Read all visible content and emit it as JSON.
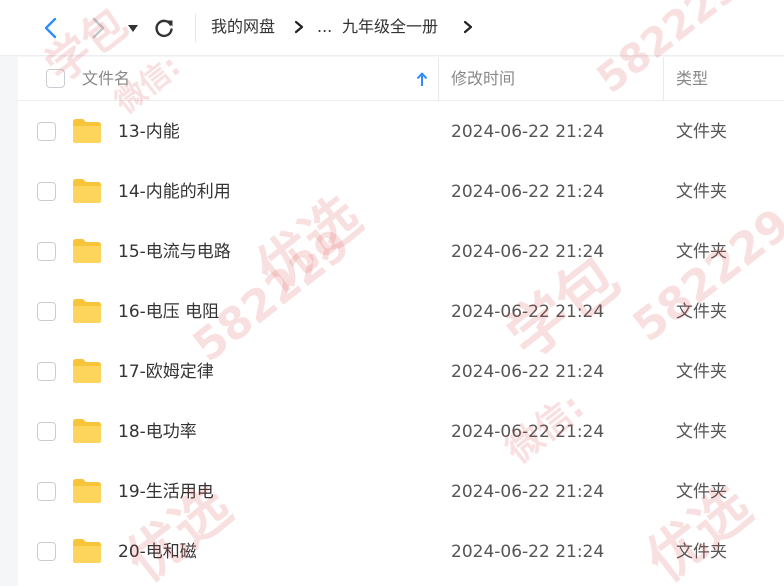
{
  "toolbar": {
    "back_icon": "chevron-left-icon",
    "forward_icon": "chevron-right-icon",
    "dropdown_icon": "caret-down-icon",
    "refresh_icon": "refresh-icon",
    "breadcrumb": {
      "root": "我的网盘",
      "ellipsis": "...",
      "current": "九年级全一册"
    },
    "accent_color": "#2f8cff"
  },
  "table": {
    "columns": {
      "name": "文件名",
      "modified": "修改时间",
      "type": "类型"
    },
    "sort_icon": "sort-up-arrow-icon",
    "folder_color": "#f8c43a",
    "rows": [
      {
        "name": "13-内能",
        "modified": "2024-06-22 21:24",
        "type": "文件夹"
      },
      {
        "name": "14-内能的利用",
        "modified": "2024-06-22 21:24",
        "type": "文件夹"
      },
      {
        "name": "15-电流与电路",
        "modified": "2024-06-22 21:24",
        "type": "文件夹"
      },
      {
        "name": "16-电压 电阻",
        "modified": "2024-06-22 21:24",
        "type": "文件夹"
      },
      {
        "name": "17-欧姆定律",
        "modified": "2024-06-22 21:24",
        "type": "文件夹"
      },
      {
        "name": "18-电功率",
        "modified": "2024-06-22 21:24",
        "type": "文件夹"
      },
      {
        "name": "19-生活用电",
        "modified": "2024-06-22 21:24",
        "type": "文件夹"
      },
      {
        "name": "20-电和磁",
        "modified": "2024-06-22 21:24",
        "type": "文件夹"
      }
    ]
  },
  "watermark": {
    "text_a": "学包",
    "text_b": "微信:",
    "text_c": "582229",
    "text_d": "优选"
  }
}
